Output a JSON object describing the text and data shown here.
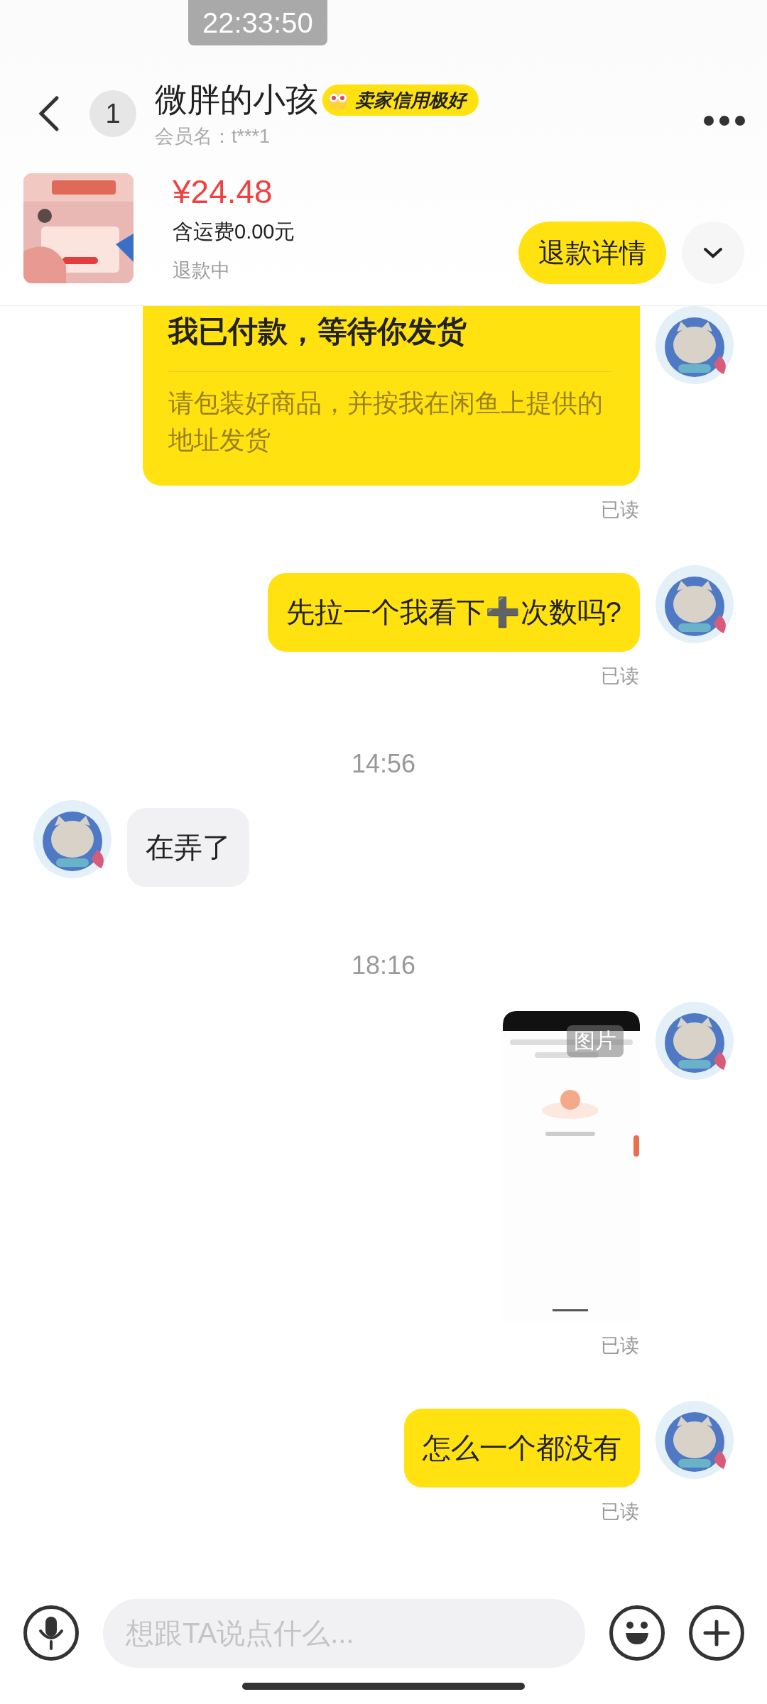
{
  "status_overlay": {
    "time": "22:33:50"
  },
  "header": {
    "back_badge": "1",
    "name": "微胖的小孩",
    "credit_tag": "卖家信用极好",
    "member": "会员名：t***1"
  },
  "order": {
    "price": "¥24.48",
    "shipping": "含运费0.00元",
    "status": "退款中",
    "button": "退款详情"
  },
  "messages": [
    {
      "kind": "card",
      "outgoing": true,
      "title": "我已付款，等待你发货",
      "body": "请包装好商品，并按我在闲鱼上提供的地址发货",
      "receipt": "已读"
    },
    {
      "kind": "text",
      "outgoing": true,
      "text": "先拉一个我看下➕次数吗?",
      "receipt": "已读"
    },
    {
      "kind": "time",
      "text": "14:56"
    },
    {
      "kind": "text",
      "outgoing": false,
      "text": "在弄了"
    },
    {
      "kind": "time",
      "text": "18:16"
    },
    {
      "outgoing": true,
      "overlay": "图片",
      "receipt": "已读"
    },
    {
      "kind": "text",
      "outgoing": true,
      "text": "怎么一个都没有",
      "receipt": "已读"
    }
  ],
  "composer": {
    "placeholder": "想跟TA说点什么..."
  }
}
